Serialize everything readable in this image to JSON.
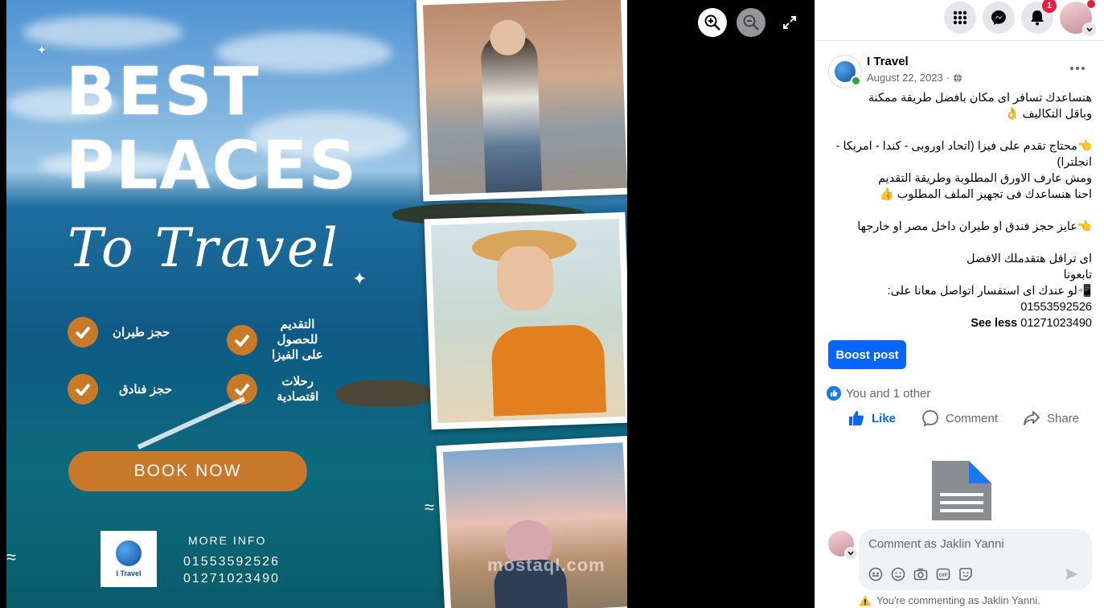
{
  "poster": {
    "line1": "BEST",
    "line2": "PLACES",
    "script": "To Travel",
    "services": {
      "flights": "حجز طيران",
      "visa": "التقديم\nللحصول\nعلى الفيزا",
      "hotels": "حجز فنادق",
      "trips": "رحلات\nاقتصادية"
    },
    "book_now": "BOOK NOW",
    "logo_text": "I Travel",
    "more_info": "MORE INFO",
    "phone1": "01553592526",
    "phone2": "01271023490",
    "watermark": "mostaql.com"
  },
  "viewer": {
    "zoom_in": "zoom-in-icon",
    "zoom_out": "zoom-out-icon",
    "fullscreen": "fullscreen-icon"
  },
  "topbar": {
    "notifications_count": "1"
  },
  "post": {
    "page_name": "I Travel",
    "date": "August 22, 2023",
    "date_sep": "·",
    "lines": [
      "هنساعدك تسافر اى مكان بافضل طريقة ممكنة",
      "وباقل التكاليف 👌",
      "",
      "👈محتاج تقدم على فيزا (اتحاد اوروبى - كندا - امريكا -",
      "انجلترا)",
      "ومش عارف الاورق المطلوبة وطريقة التقديم",
      "احنا هنساعدك فى تجهيز الملف المطلوب 👍",
      "",
      "👈عايز حجز فندق او طيران داخل مصر او خارجها",
      "",
      "اى ترافل هتقدملك الافضل",
      "تابعونا",
      "📲لو عندك اى استفسار اتواصل معانا على:",
      "01553592526"
    ],
    "last_phone": "01271023490",
    "see_less": "See less",
    "boost_label": "Boost post",
    "reactions": "You and 1 other",
    "like": "Like",
    "comment": "Comment",
    "share": "Share",
    "comment_placeholder": "Comment as Jaklin Yanni",
    "notice": "You're commenting as Jaklin Yanni."
  },
  "colors": {
    "accent": "#0866ff",
    "orange": "#c8782a",
    "badge": "#e41e3f"
  }
}
